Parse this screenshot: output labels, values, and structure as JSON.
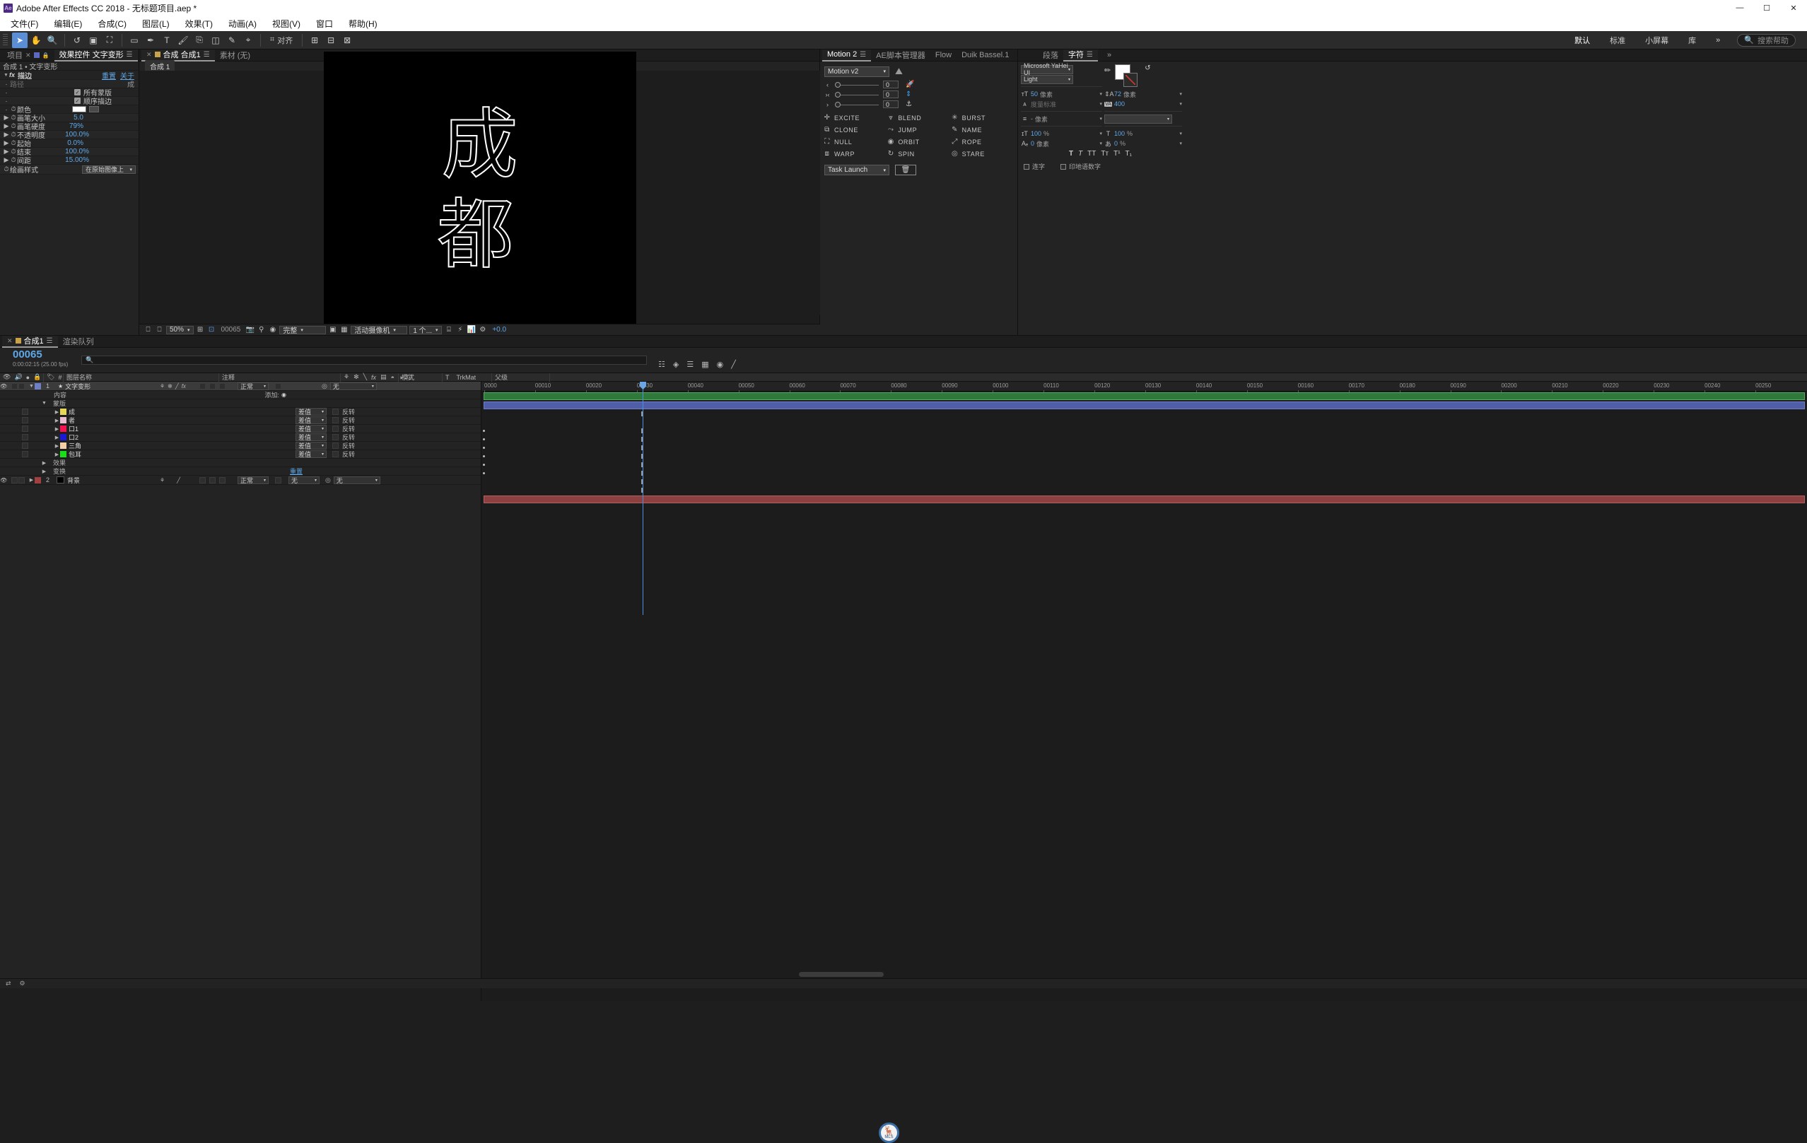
{
  "titlebar": {
    "app_badge": "Ae",
    "title": "Adobe After Effects CC 2018 - 无标题项目.aep *",
    "minimize": "—",
    "maximize": "☐",
    "close": "✕"
  },
  "menubar": {
    "items": [
      {
        "label": "文件(F)"
      },
      {
        "label": "编辑(E)"
      },
      {
        "label": "合成(C)"
      },
      {
        "label": "图层(L)"
      },
      {
        "label": "效果(T)"
      },
      {
        "label": "动画(A)"
      },
      {
        "label": "视图(V)"
      },
      {
        "label": "窗口"
      },
      {
        "label": "帮助(H)"
      }
    ]
  },
  "toolbar": {
    "tools": [
      {
        "name": "selection-tool",
        "glyph": "➤"
      },
      {
        "name": "hand-tool",
        "glyph": "✋"
      },
      {
        "name": "zoom-tool",
        "glyph": "🔍"
      },
      {
        "name": "rotation-tool",
        "glyph": "↺"
      },
      {
        "name": "camera-tool",
        "glyph": "🎥"
      },
      {
        "name": "pan-behind-tool",
        "glyph": "⛶"
      },
      {
        "name": "shape-tool",
        "glyph": "▭"
      },
      {
        "name": "pen-tool",
        "glyph": "✒"
      },
      {
        "name": "type-tool",
        "glyph": "T"
      },
      {
        "name": "brush-tool",
        "glyph": "🖌"
      },
      {
        "name": "clone-stamp-tool",
        "glyph": "⎘"
      },
      {
        "name": "eraser-tool",
        "glyph": "◫"
      },
      {
        "name": "roto-brush-tool",
        "glyph": "✎"
      },
      {
        "name": "puppet-pin-tool",
        "glyph": "⌖"
      }
    ],
    "snapping_label": "对齐",
    "align_icons": [
      "⊞",
      "⊟",
      "⊠"
    ],
    "workspaces": [
      "默认",
      "标准",
      "小屏幕",
      "库"
    ],
    "workspace_selected": "默认",
    "overflow": "»",
    "search_placeholder": "搜索帮助",
    "search_icon": "search-icon"
  },
  "effect_controls": {
    "tabs": [
      {
        "label": "项目",
        "active": false,
        "closeable": true
      },
      {
        "label": "效果控件 文字变形",
        "active": true,
        "closeable": false
      }
    ],
    "lock_icon": "lock-icon",
    "breadcrumb": "合成 1 • 文字变形",
    "effect_name": "描边",
    "reset_label": "重置",
    "about_label": "关于",
    "properties": [
      {
        "label": "路径",
        "value": "成",
        "type": "dropdown",
        "dim": true
      },
      {
        "label": "",
        "check_label": "所有蒙版",
        "type": "check",
        "checked": true
      },
      {
        "label": "",
        "check_label": "顺序描边",
        "type": "check",
        "checked": true
      },
      {
        "label": "颜色",
        "value": "#FFFFFF",
        "type": "color"
      },
      {
        "label": "画笔大小",
        "value": "5.0",
        "type": "number"
      },
      {
        "label": "画笔硬度",
        "value": "79%",
        "type": "number"
      },
      {
        "label": "不透明度",
        "value": "100.0%",
        "type": "number"
      },
      {
        "label": "起始",
        "value": "0.0%",
        "type": "number"
      },
      {
        "label": "结束",
        "value": "100.0%",
        "type": "number"
      },
      {
        "label": "间距",
        "value": "15.00%",
        "type": "number"
      },
      {
        "label": "绘画样式",
        "value": "在原始图像上",
        "type": "select"
      }
    ]
  },
  "comp_panel": {
    "tabs": [
      {
        "label": "合成 合成1",
        "active": true,
        "closeable": true
      },
      {
        "label": "素材 (无)",
        "active": false,
        "closeable": false
      }
    ],
    "subtab": "合成 1",
    "canvas_text_line1": "成",
    "canvas_text_line2": "都",
    "viewer_toolbar": {
      "zoom": "50%",
      "frame": "00065",
      "resolution": "完整",
      "camera": "活动摄像机",
      "views": "1 个...",
      "exposure": "+0.0",
      "icons": [
        "always-preview-icon",
        "monitor-icon",
        "region-of-interest-icon",
        "transparency-grid-icon",
        "snapshot-icon",
        "show-snapshot-icon",
        "channel-icon",
        "mask-icon",
        "guides-icon",
        "timeline-graph-icon",
        "3d-view-icon",
        "renderer-icon"
      ]
    }
  },
  "motion_panel": {
    "tabs": [
      {
        "label": "Motion 2",
        "active": true
      },
      {
        "label": "AE脚本管理器",
        "active": false
      },
      {
        "label": "Flow",
        "active": false
      },
      {
        "label": "Duik Bassel.1",
        "active": false
      }
    ],
    "version_select": "Motion v2",
    "logo_icon": "mountains-icon",
    "sliders": [
      {
        "icon": "‹",
        "value": "0",
        "side_icon": "rocket-icon"
      },
      {
        "icon": "›‹",
        "value": "0",
        "side_icon": "vertical-arrows-icon"
      },
      {
        "icon": "›",
        "value": "0",
        "side_icon": "anchor-icon"
      }
    ],
    "buttons": [
      {
        "label": "EXCITE",
        "icon": "plus-icon"
      },
      {
        "label": "BLEND",
        "icon": "blend-icon"
      },
      {
        "label": "BURST",
        "icon": "burst-icon"
      },
      {
        "label": "CLONE",
        "icon": "clone-icon"
      },
      {
        "label": "JUMP",
        "icon": "jump-icon"
      },
      {
        "label": "NAME",
        "icon": "pencil-icon"
      },
      {
        "label": "NULL",
        "icon": "null-icon"
      },
      {
        "label": "ORBIT",
        "icon": "orbit-icon"
      },
      {
        "label": "ROPE",
        "icon": "rope-icon"
      },
      {
        "label": "WARP",
        "icon": "warp-icon"
      },
      {
        "label": "SPIN",
        "icon": "spin-icon"
      },
      {
        "label": "STARE",
        "icon": "eye-icon"
      }
    ],
    "task_select": "Task Launch",
    "trash_icon": "trash-icon"
  },
  "character_panel": {
    "tabs": [
      {
        "label": "段落",
        "active": false
      },
      {
        "label": "字符",
        "active": true
      }
    ],
    "overflow": "»",
    "font_family": "Microsoft YaHei UI",
    "font_style": "Light",
    "eyedropper_icon": "eyedropper-icon",
    "swap_icon": "swap-colors-icon",
    "fill_color": "#FFFFFF",
    "font_size": {
      "icon": "font-size-icon",
      "value": "50",
      "unit": "像素"
    },
    "leading": {
      "icon": "leading-icon",
      "value": "72",
      "unit": "像素"
    },
    "kerning": {
      "icon": "kerning-icon",
      "value": "度量标准",
      "unit": ""
    },
    "tracking": {
      "icon": "tracking-icon",
      "value": "400",
      "unit": ""
    },
    "stroke_width": {
      "icon": "stroke-width-icon",
      "value": "-",
      "unit": "像素"
    },
    "stroke_type": "",
    "vscale": {
      "icon": "vertical-scale-icon",
      "value": "100",
      "unit": "%"
    },
    "hscale": {
      "icon": "horizontal-scale-icon",
      "value": "100",
      "unit": "%"
    },
    "baseline": {
      "icon": "baseline-shift-icon",
      "value": "0",
      "unit": "像素"
    },
    "tsume": {
      "icon": "tsume-icon",
      "value": "0",
      "unit": "%"
    },
    "styles": [
      "T",
      "T",
      "TT",
      "Tᴛ",
      "T¹",
      "T₁"
    ],
    "checkbox_ligature": "连字",
    "checkbox_hindi": "印地语数字"
  },
  "timeline": {
    "tabs": [
      {
        "label": "合成1",
        "active": true,
        "closeable": true
      },
      {
        "label": "渲染队列",
        "active": false,
        "closeable": false
      }
    ],
    "current_frame": "00065",
    "timecode": "0:00:02:15 (25.00 fps)",
    "search_placeholder": "",
    "search_icon": "search-icon",
    "toolbar_icons": [
      "composition-mini-flowchart-icon",
      "draft-3d-icon",
      "hide-shy-layers-icon",
      "frame-blending-icon",
      "motion-blur-icon",
      "graph-editor-icon"
    ],
    "columns": {
      "visibility": "eye-icon",
      "audio": "speaker-icon",
      "solo": "solo-icon",
      "lock": "lock-icon",
      "label": "label-icon",
      "index": "#",
      "layer_name": "图层名称",
      "comment": "注释",
      "switches": [
        "parent-icon",
        "shy-icon",
        "quality-icon",
        "fx-icon",
        "frameblend-icon",
        "motionblur-icon",
        "adjustment-icon",
        "3d-icon"
      ],
      "mode": "模式",
      "t": "T",
      "trkmat": "TrkMat",
      "parent": "父级"
    },
    "layers": [
      {
        "index": "1",
        "name": "文字变形",
        "label_color": "#6f7fc4",
        "mode": "正常",
        "trkmat": "",
        "parent": "无",
        "selected": true,
        "star": "★",
        "track_color": "blue",
        "children": [
          {
            "name": "内容",
            "indent": 2,
            "add_label": "添加:"
          },
          {
            "name": "蒙版",
            "indent": 2,
            "twirl": true
          },
          {
            "name": "成",
            "indent": 4,
            "color": "#e8d857",
            "mode": "差值",
            "invert": "反转"
          },
          {
            "name": "者",
            "indent": 4,
            "color": "#e8bdd0",
            "mode": "差值",
            "invert": "反转"
          },
          {
            "name": "口1",
            "indent": 4,
            "color": "#f5124e",
            "mode": "差值",
            "invert": "反转"
          },
          {
            "name": "口2",
            "indent": 4,
            "color": "#1a1ad6",
            "mode": "差值",
            "invert": "反转"
          },
          {
            "name": "三角",
            "indent": 4,
            "color": "#f2cfa8",
            "mode": "差值",
            "invert": "反转"
          },
          {
            "name": "包耳",
            "indent": 4,
            "color": "#18e018",
            "mode": "差值",
            "invert": "反转"
          },
          {
            "name": "效果",
            "indent": 3,
            "twirl": true
          },
          {
            "name": "变换",
            "indent": 3,
            "twirl": true,
            "reset": "重置"
          }
        ]
      },
      {
        "index": "2",
        "name": "背景",
        "label_color": "#a04040",
        "mode": "正常",
        "trkmat": "无",
        "parent": "无",
        "selected": false,
        "track_color": "red",
        "children": []
      }
    ],
    "ruler_ticks": [
      "0000",
      "00010",
      "00020",
      "00030",
      "00040",
      "00050",
      "00060",
      "00070",
      "00080",
      "00090",
      "00100",
      "00110",
      "00120",
      "00130",
      "00140",
      "00150",
      "00160",
      "00170",
      "00180",
      "00190",
      "00200",
      "00210",
      "00220",
      "00230",
      "00240",
      "00250"
    ],
    "playhead_frame": "00065",
    "footer_icons": [
      "toggle-switches-modes-icon",
      "settings-icon"
    ],
    "zoom_icons": [
      "zoom-out-icon",
      "zoom-in-icon",
      "fit-icon"
    ]
  },
  "badge": {
    "icon": "deer-icon",
    "label": "MLS"
  },
  "colors": {
    "accent_blue": "#5fa8e8",
    "panel_bg": "#232323",
    "chrome": "#2b2b2b",
    "track_green": "#2f7a3a",
    "track_blue": "#4f5ea6",
    "track_red": "#8d4040"
  }
}
